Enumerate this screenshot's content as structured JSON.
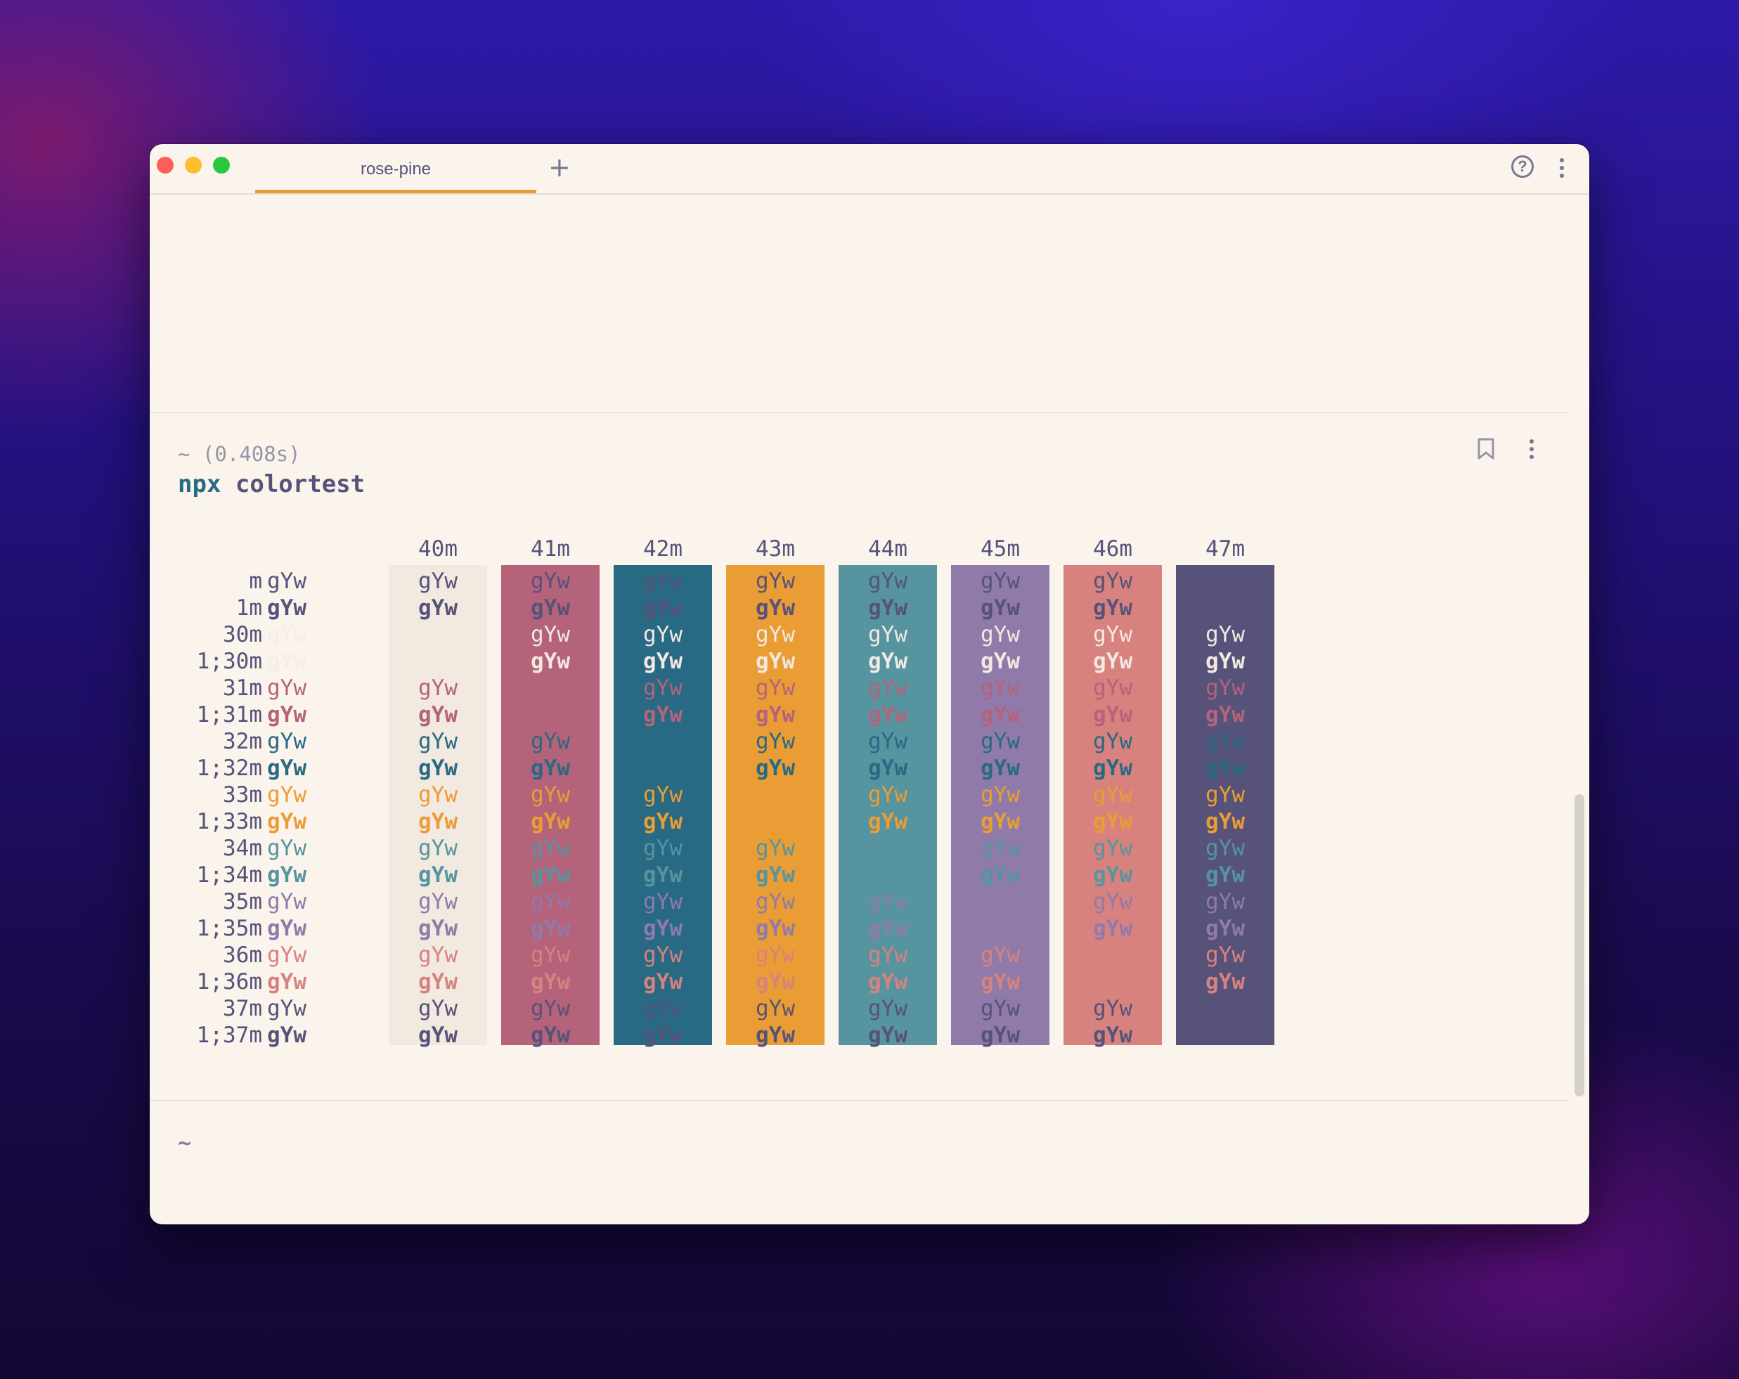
{
  "window": {
    "tab_title": "rose-pine",
    "new_tab_symbol": "+",
    "help_symbol": "?"
  },
  "block": {
    "prompt": "~ (0.408s)",
    "command_npx": "npx",
    "command_rest": " colortest"
  },
  "input_prompt": "~",
  "colortest": {
    "sample_text": "gYw",
    "row_labels": [
      "m",
      "1m",
      "30m",
      "1;30m",
      "31m",
      "1;31m",
      "32m",
      "1;32m",
      "33m",
      "1;33m",
      "34m",
      "1;34m",
      "35m",
      "1;35m",
      "36m",
      "1;36m",
      "37m",
      "1;37m"
    ],
    "column_headers": [
      "40m",
      "41m",
      "42m",
      "43m",
      "44m",
      "45m",
      "46m",
      "47m"
    ],
    "palette": {
      "base": "#faf4ed",
      "surface": "#f2e9e1",
      "text": "#575279",
      "black": "#f2e9e1",
      "red": "#b4637a",
      "green": "#286983",
      "yellow": "#ea9d34",
      "blue": "#56949f",
      "magenta": "#907aa9",
      "cyan": "#d7827e",
      "white": "#575279"
    }
  }
}
